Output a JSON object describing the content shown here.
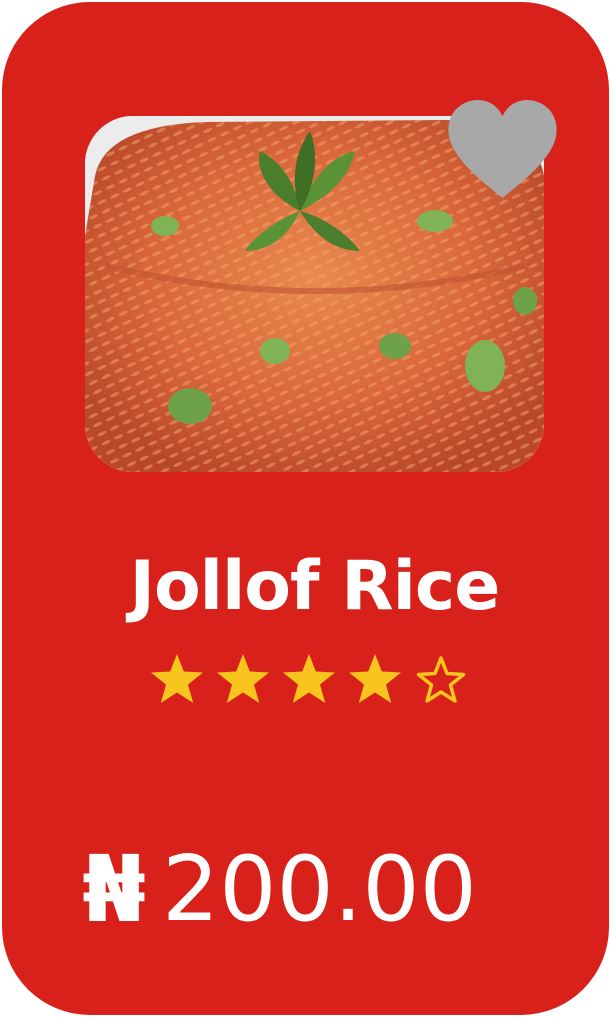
{
  "product": {
    "name": "Jollof Rice",
    "rating": 4,
    "max_rating": 5,
    "currency_symbol": "₦",
    "price": "200.00"
  },
  "icons": {
    "favorite": "heart-icon",
    "rating_filled": "star-filled-icon",
    "rating_empty": "star-outline-icon"
  },
  "colors": {
    "card_background": "#d8211a",
    "text": "#ffffff",
    "star": "#f7c51e",
    "favorite_heart": "#a8a8a8"
  }
}
